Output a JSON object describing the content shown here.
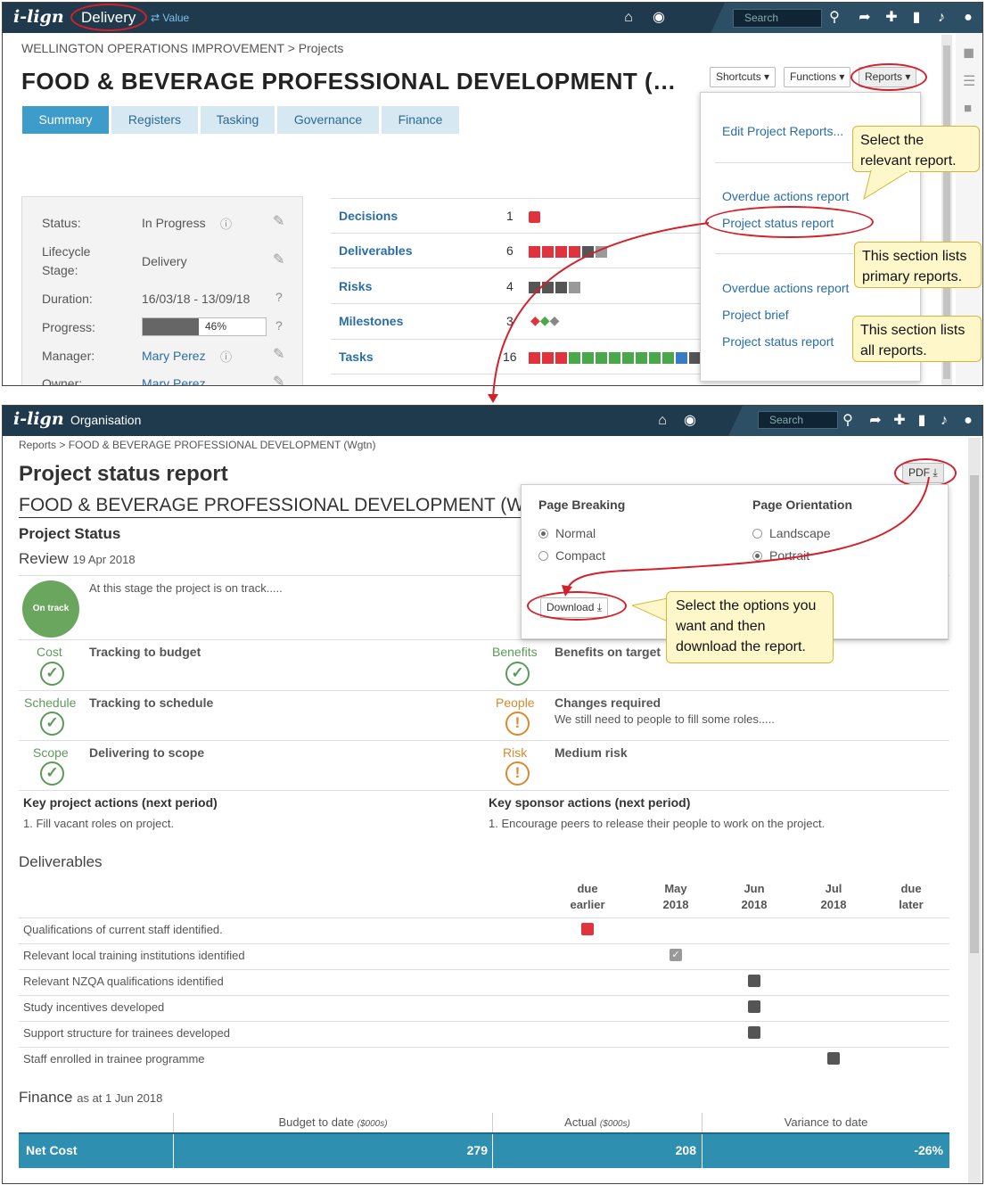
{
  "top": {
    "app_logo": "i-lign",
    "module": "Delivery",
    "switch_label": "Value",
    "search_placeholder": "Search",
    "breadcrumb": "WELLINGTON OPERATIONS IMPROVEMENT > Projects",
    "title": "FOOD & BEVERAGE PROFESSIONAL DEVELOPMENT (…",
    "tabs": [
      "Summary",
      "Registers",
      "Tasking",
      "Governance",
      "Finance"
    ],
    "buttons": {
      "shortcuts": "Shortcuts",
      "functions": "Functions",
      "reports": "Reports"
    },
    "status_panel": {
      "status_label": "Status:",
      "status_value": "In Progress",
      "lifecycle_label_1": "Lifecycle",
      "lifecycle_label_2": "Stage:",
      "lifecycle_value": "Delivery",
      "duration_label": "Duration:",
      "duration_value": "16/03/18 - 13/09/18",
      "progress_label": "Progress:",
      "progress_value": "46%",
      "progress_fraction": 0.46,
      "manager_label": "Manager:",
      "manager_value": "Mary Perez",
      "owner_label": "Owner:",
      "owner_value": "Mary Perez"
    },
    "registers": [
      {
        "name": "Decisions",
        "count": "1"
      },
      {
        "name": "Deliverables",
        "count": "6"
      },
      {
        "name": "Risks",
        "count": "4"
      },
      {
        "name": "Milestones",
        "count": "3"
      },
      {
        "name": "Tasks",
        "count": "16"
      }
    ],
    "reports_menu": {
      "edit": "Edit Project Reports...",
      "primary": [
        "Overdue actions report",
        "Project status report"
      ],
      "all": [
        "Overdue actions report",
        "Project brief",
        "Project status report"
      ]
    },
    "callouts": {
      "select": "Select the relevant report.",
      "primary": "This section lists primary reports.",
      "all": "This section lists all reports."
    }
  },
  "bottom": {
    "app_logo": "i-lign",
    "module": "Organisation",
    "search_placeholder": "Search",
    "breadcrumb": "Reports > FOOD & BEVERAGE PROFESSIONAL DEVELOPMENT (Wgtn)",
    "title": "Project status report",
    "project_name": "FOOD & BEVERAGE PROFESSIONAL DEVELOPMENT (W",
    "pdf_label": "PDF",
    "section_status": "Project Status",
    "review_label": "Review",
    "review_date": "19 Apr 2018",
    "badge": "On track",
    "summary_text": "At this stage the project is on track.....",
    "pdf_options": {
      "page_breaking": "Page Breaking",
      "normal": "Normal",
      "compact": "Compact",
      "page_orientation": "Page Orientation",
      "landscape": "Landscape",
      "portrait": "Portrait",
      "download": "Download"
    },
    "download_callout": "Select the options you want and then download the report.",
    "measures": {
      "cost": {
        "label": "Cost",
        "text": "Tracking to budget"
      },
      "schedule": {
        "label": "Schedule",
        "text": "Tracking to schedule"
      },
      "scope": {
        "label": "Scope",
        "text": "Delivering to scope"
      },
      "benefits": {
        "label": "Benefits",
        "text": "Benefits on target"
      },
      "people": {
        "label": "People",
        "text": "Changes required",
        "sub": "We still need to people to fill some roles....."
      },
      "risk": {
        "label": "Risk",
        "text": "Medium risk"
      }
    },
    "key_project": {
      "heading": "Key project actions (next period)",
      "item": "1. Fill vacant roles on project."
    },
    "key_sponsor": {
      "heading": "Key sponsor actions (next period)",
      "item": "1. Encourage peers to release their people to work on the project."
    },
    "deliverables_heading": "Deliverables",
    "deliv_cols": [
      [
        "due",
        "earlier"
      ],
      [
        "May",
        "2018"
      ],
      [
        "Jun",
        "2018"
      ],
      [
        "Jul",
        "2018"
      ],
      [
        "due",
        "later"
      ]
    ],
    "deliverables": [
      "Qualifications of current staff identified.",
      "Relevant local training institutions identified",
      "Relevant NZQA qualifications identified",
      "Study incentives developed",
      "Support structure for trainees developed",
      "Staff enrolled in trainee programme"
    ],
    "finance_heading": "Finance",
    "finance_asat": "as at 1 Jun 2018",
    "finance_cols": {
      "budget": "Budget to date",
      "budget_unit": "($000s)",
      "actual": "Actual",
      "actual_unit": "($000s)",
      "variance": "Variance to date"
    },
    "finance_row": {
      "label": "Net Cost",
      "budget": "279",
      "actual": "208",
      "variance": "-26%"
    }
  },
  "colors": {
    "navy": "#1f3a4d",
    "teal": "#2f8fb0",
    "red": "#d4202a",
    "green": "#5c9a5a",
    "amber": "#d88a2d"
  }
}
